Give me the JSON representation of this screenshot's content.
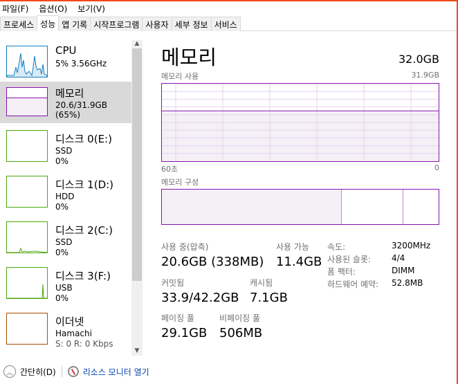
{
  "menu": [
    "파일(F)",
    "옵션(O)",
    "보기(V)"
  ],
  "tabs": [
    "프로세스",
    "성능",
    "앱 기록",
    "시작프로그램",
    "사용자",
    "세부 정보",
    "서비스"
  ],
  "active_tab": 1,
  "colors": {
    "cpu": "#117dbb",
    "memory": "#8b12ae",
    "disk": "#4da60c",
    "ethernet": "#a74f01",
    "accent_window": "#f04a1c"
  },
  "sidebar": [
    {
      "name": "CPU",
      "line2": "5% 3.56GHz",
      "line3": ""
    },
    {
      "name": "메모리",
      "line2": "20.6/31.9GB (65%)",
      "line3": ""
    },
    {
      "name": "디스크 0(E:)",
      "line2": "SSD",
      "line3": "0%"
    },
    {
      "name": "디스크 1(D:)",
      "line2": "HDD",
      "line3": "0%"
    },
    {
      "name": "디스크 2(C:)",
      "line2": "SSD",
      "line3": "0%"
    },
    {
      "name": "디스크 3(F:)",
      "line2": "USB",
      "line3": "0%"
    },
    {
      "name": "이더넷",
      "line2": "Hamachi",
      "line3": "S: 0 R: 0 Kbps"
    }
  ],
  "main": {
    "title": "메모리",
    "total": "32.0GB",
    "usage_label": "메모리 사용",
    "usage_max": "31.9GB",
    "axis_left": "60초",
    "axis_right": "0",
    "usage_percent": 65,
    "composition_label": "메모리 구성",
    "stats": [
      {
        "k": "사용 중(압축)",
        "v": "20.6GB (338MB)"
      },
      {
        "k": "사용 가능",
        "v": "11.4GB"
      },
      {
        "k": "커밋됨",
        "v": "33.9/42.2GB"
      },
      {
        "k": "캐시됨",
        "v": "7.1GB"
      },
      {
        "k": "페이징 풀",
        "v": "29.1GB"
      },
      {
        "k": "비페이징 풀",
        "v": "506MB"
      }
    ],
    "props": [
      {
        "k": "속도:",
        "v": "3200MHz"
      },
      {
        "k": "사용된 슬롯:",
        "v": "4/4"
      },
      {
        "k": "폼 팩터:",
        "v": "DIMM"
      },
      {
        "k": "하드웨어 예약:",
        "v": "52.8MB"
      }
    ]
  },
  "footer": {
    "collapse": "간단히(D)",
    "resmon": "리소스 모니터 열기"
  }
}
